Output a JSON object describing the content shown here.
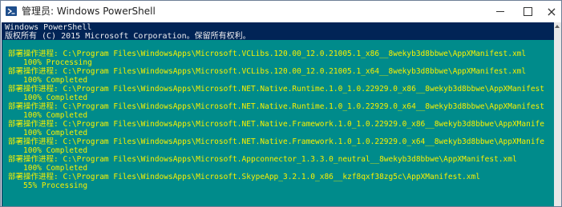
{
  "window": {
    "title": "管理员: Windows PowerShell",
    "icon": "powershell-icon"
  },
  "caption_buttons": {
    "minimize": "minimize-icon",
    "maximize": "maximize-icon",
    "close": "×"
  },
  "console": {
    "header_lines": [
      "Windows PowerShell",
      "版权所有 (C) 2015 Microsoft Corporation。保留所有权利。"
    ],
    "operations": [
      {
        "operation": "部署操作进程: C:\\Program Files\\WindowsApps\\Microsoft.VCLibs.120.00_12.0.21005.1_x86__8wekyb3d8bbwe\\AppXManifest.xml",
        "status": "100% Processing"
      },
      {
        "operation": "部署操作进程: C:\\Program Files\\WindowsApps\\Microsoft.VCLibs.120.00_12.0.21005.1_x64__8wekyb3d8bbwe\\AppXManifest.xml",
        "status": "100% Completed"
      },
      {
        "operation": "部署操作进程: C:\\Program Files\\WindowsApps\\Microsoft.NET.Native.Runtime.1.0_1.0.22929.0_x86__8wekyb3d8bbwe\\AppXManifest",
        "status": "100% Completed"
      },
      {
        "operation": "部署操作进程: C:\\Program Files\\WindowsApps\\Microsoft.NET.Native.Runtime.1.0_1.0.22929.0_x64__8wekyb3d8bbwe\\AppXManifest",
        "status": "100% Completed"
      },
      {
        "operation": "部署操作进程: C:\\Program Files\\WindowsApps\\Microsoft.NET.Native.Framework.1.0_1.0.22929.0_x86__8wekyb3d8bbwe\\AppXManife",
        "status": "100% Completed"
      },
      {
        "operation": "部署操作进程: C:\\Program Files\\WindowsApps\\Microsoft.NET.Native.Framework.1.0_1.0.22929.0_x64__8wekyb3d8bbwe\\AppXManife",
        "status": "100% Completed"
      },
      {
        "operation": "部署操作进程: C:\\Program Files\\WindowsApps\\Microsoft.Appconnector_1.3.3.0_neutral__8wekyb3d8bbwe\\AppXManifest.xml",
        "status": "100% Completed"
      },
      {
        "operation": "部署操作进程: C:\\Program Files\\WindowsApps\\Microsoft.SkypeApp_3.2.1.0_x86__kzf8qxf38zg5c\\AppXManifest.xml",
        "status": "55% Processing"
      }
    ]
  },
  "colors": {
    "console_background": "#012456",
    "progress_background": "#008b8b",
    "progress_text": "#f8f000",
    "header_text": "#eeedf0"
  }
}
